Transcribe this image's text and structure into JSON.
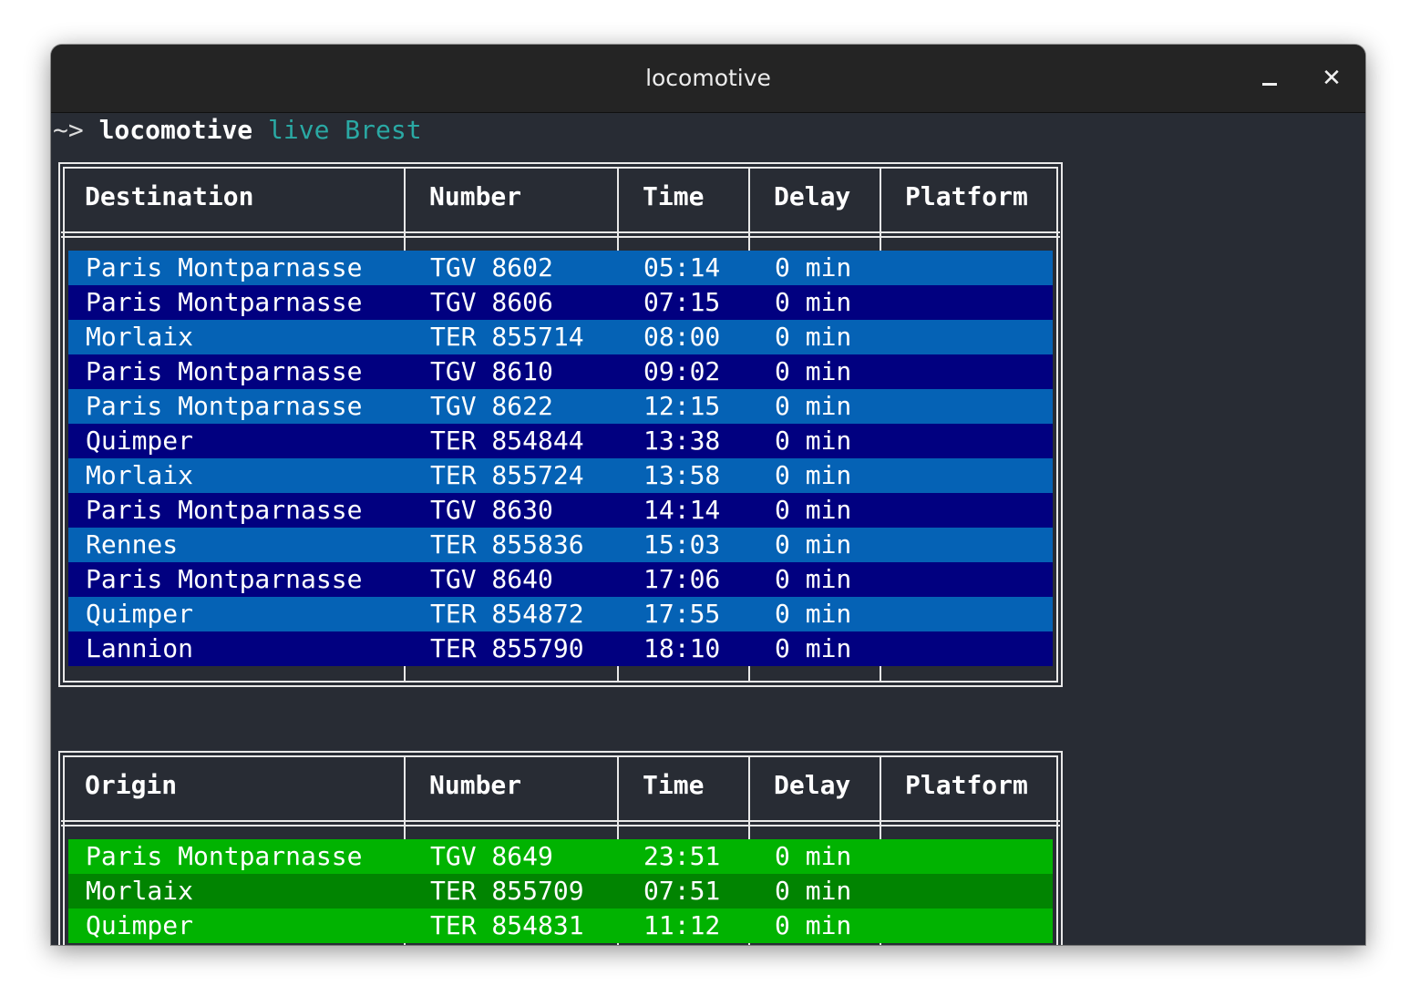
{
  "window": {
    "title": "locomotive",
    "minimize_glyph": "",
    "close_glyph": "✕"
  },
  "prompt": {
    "symbol": "~>",
    "command": "locomotive",
    "args": "live Brest"
  },
  "colors": {
    "terminal_bg": "#282c34",
    "departure_row_light": "#0562b5",
    "departure_row_dark": "#010080",
    "arrival_row_light": "#01b301",
    "arrival_row_dark": "#018401",
    "prompt_args": "#2aa9a4"
  },
  "departures": {
    "headers": [
      "Destination",
      "Number",
      "Time",
      "Delay",
      "Platform"
    ],
    "rows": [
      [
        "Paris Montparnasse",
        "TGV 8602",
        "05:14",
        "0 min",
        ""
      ],
      [
        "Paris Montparnasse",
        "TGV 8606",
        "07:15",
        "0 min",
        ""
      ],
      [
        "Morlaix",
        "TER 855714",
        "08:00",
        "0 min",
        ""
      ],
      [
        "Paris Montparnasse",
        "TGV 8610",
        "09:02",
        "0 min",
        ""
      ],
      [
        "Paris Montparnasse",
        "TGV 8622",
        "12:15",
        "0 min",
        ""
      ],
      [
        "Quimper",
        "TER 854844",
        "13:38",
        "0 min",
        ""
      ],
      [
        "Morlaix",
        "TER 855724",
        "13:58",
        "0 min",
        ""
      ],
      [
        "Paris Montparnasse",
        "TGV 8630",
        "14:14",
        "0 min",
        ""
      ],
      [
        "Rennes",
        "TER 855836",
        "15:03",
        "0 min",
        ""
      ],
      [
        "Paris Montparnasse",
        "TGV 8640",
        "17:06",
        "0 min",
        ""
      ],
      [
        "Quimper",
        "TER 854872",
        "17:55",
        "0 min",
        ""
      ],
      [
        "Lannion",
        "TER 855790",
        "18:10",
        "0 min",
        ""
      ]
    ]
  },
  "arrivals": {
    "headers": [
      "Origin",
      "Number",
      "Time",
      "Delay",
      "Platform"
    ],
    "rows": [
      [
        "Paris Montparnasse",
        "TGV 8649",
        "23:51",
        "0 min",
        ""
      ],
      [
        "Morlaix",
        "TER 855709",
        "07:51",
        "0 min",
        ""
      ],
      [
        "Quimper",
        "TER 854831",
        "11:12",
        "0 min",
        ""
      ]
    ]
  }
}
